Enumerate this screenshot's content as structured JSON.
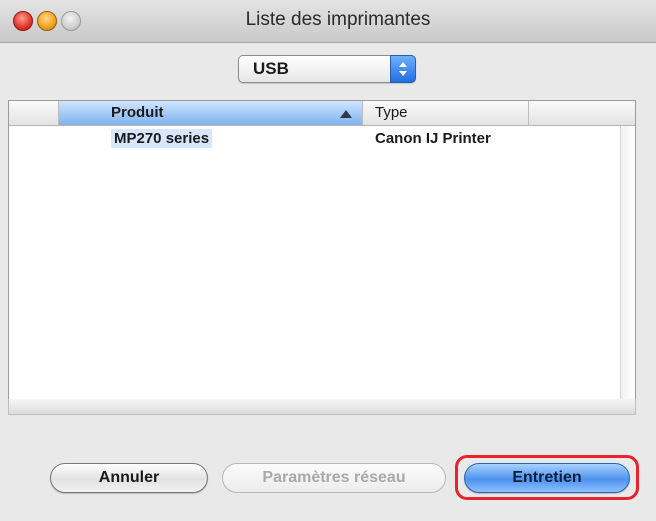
{
  "window": {
    "title": "Liste des imprimantes"
  },
  "connection_popup": {
    "selected": "USB"
  },
  "table": {
    "columns": [
      "Produit",
      "Type"
    ],
    "sort_column": "Produit",
    "rows": [
      {
        "produit": "MP270 series",
        "type": "Canon IJ Printer"
      }
    ]
  },
  "buttons": {
    "cancel": "Annuler",
    "network_settings": "Paramètres réseau",
    "maintenance": "Entretien"
  },
  "colors": {
    "highlight": "#e8232a",
    "selection": "#7fb3ee",
    "default_button": "#4d93f0"
  },
  "icons": [
    "close-icon",
    "minimize-icon",
    "zoom-icon",
    "popup-arrows-icon",
    "sort-ascending-icon"
  ]
}
